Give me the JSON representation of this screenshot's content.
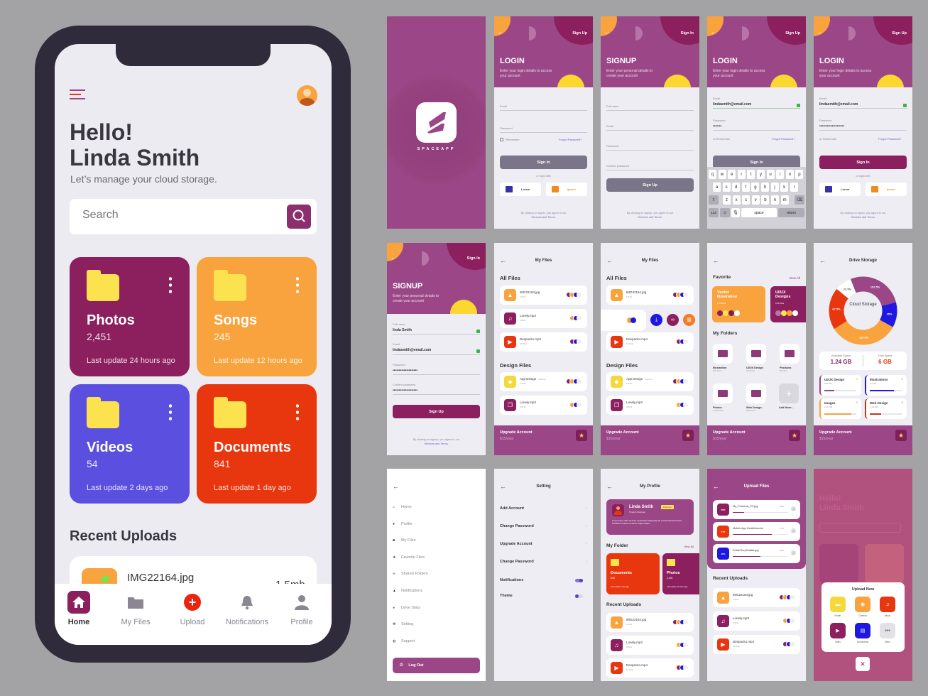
{
  "main": {
    "greeting": "Hello!",
    "name": "Linda Smith",
    "subtitle": "Let’s manage your cloud storage.",
    "search_placeholder": "Search",
    "categories": [
      {
        "name": "Photos",
        "count": "2,451",
        "updated": "Last update 24 hours ago",
        "color": "#8c1f5e"
      },
      {
        "name": "Songs",
        "count": "245",
        "updated": "Last update 12 hours ago",
        "color": "#f8a33d"
      },
      {
        "name": "Videos",
        "count": "54",
        "updated": "Last update 2 days ago",
        "color": "#5b4fdf"
      },
      {
        "name": "Documents",
        "count": "841",
        "updated": "Last update 1 day ago",
        "color": "#e8360f"
      }
    ],
    "recent_title": "Recent Uploads",
    "recent_file": {
      "name": "IMG22164.jpg",
      "size": "1.5mb"
    },
    "nav": [
      "Home",
      "My Files",
      "Upload",
      "Notifications",
      "Profile"
    ],
    "nav_active": "Home"
  },
  "splash": {
    "brand": "SPACEAPP"
  },
  "login": {
    "title": "LOGIN",
    "subtitle": "Enter your login details to access your account",
    "top_link": "Sign Up",
    "email_label": "Email",
    "password_label": "Password",
    "remember": "Remember",
    "forgot": "Forgot Password?",
    "sign_in": "Sign In",
    "or": "or login with",
    "social": [
      "Lorem",
      "Ipsum"
    ],
    "footer": "By clicking on signin, you agree to our",
    "footer_link": "Services and Terms."
  },
  "signup": {
    "title": "SIGNUP",
    "subtitle": "Enter your personal details to create your account",
    "top_link": "Sign In",
    "fields": [
      "Full name",
      "Email",
      "Password",
      "Confirm password"
    ],
    "button": "Sign Up",
    "footer": "By clicking on signup, you agree to our",
    "footer_link": "Services and Terms."
  },
  "login_filled": {
    "email": "lindasmith@email.com",
    "password_typing": "•••••••",
    "password_full": "••••••••••••••••••••"
  },
  "keyboard": {
    "rows": [
      [
        "q",
        "w",
        "e",
        "r",
        "t",
        "y",
        "u",
        "i",
        "o",
        "p"
      ],
      [
        "a",
        "s",
        "d",
        "f",
        "g",
        "h",
        "j",
        "k",
        "l"
      ],
      [
        "z",
        "x",
        "c",
        "v",
        "b",
        "n",
        "m"
      ]
    ],
    "numbers": "123",
    "space": "space",
    "return": "return"
  },
  "signup_filled": {
    "full_name": "linda Smith",
    "email": "lindasmith@email.com",
    "password": "••••••••••••••••••••",
    "confirm": "••••••••••••••••••••"
  },
  "my_files": {
    "title": "My Files",
    "all_files": "All Files",
    "design_files": "Design Files",
    "files": [
      {
        "name": "IMG22164.jpg",
        "size": "1.5mb",
        "icon": "image-icon",
        "color": "#f8a33d"
      },
      {
        "name": "Lonely.mp3",
        "size": "3.5mb",
        "icon": "music-icon",
        "color": "#8c1f5e"
      },
      {
        "name": "Despacito.mp4",
        "size": "10.5mb",
        "icon": "video-icon",
        "color": "#e8360f"
      }
    ],
    "design": [
      {
        "name": "App Design",
        "tag": "drawing",
        "size": "1.5mb",
        "icon": "diamond-icon",
        "color": "#f5d83c"
      },
      {
        "name": "Lonely.mp3",
        "size": "3.5mb",
        "icon": "copy-icon",
        "color": "#8c1f5e"
      }
    ]
  },
  "upgrade": {
    "title": "Upgrade Account",
    "price": "$15/year"
  },
  "favorites": {
    "title": "Favorite",
    "view_all": "View All",
    "cards": [
      {
        "name": "Vector Illustration",
        "count": "105 Files",
        "color": "#f8a33d"
      },
      {
        "name": "UI/UX Designs",
        "count": "154 Files",
        "color": "#8c1f5e"
      }
    ],
    "folders_title": "My Folders",
    "folders": [
      {
        "name": "Illustration",
        "count": "105 Files"
      },
      {
        "name": "UI/UX Design",
        "count": "150 Files"
      },
      {
        "name": "Products",
        "count": "59 Files"
      },
      {
        "name": "Photos",
        "count": "2,310 Files"
      },
      {
        "name": "Web Design",
        "count": "310 Files"
      }
    ],
    "add_more": "Add More..."
  },
  "drive": {
    "title": "Drive Storage",
    "center": "Cloud Storage",
    "segments": [
      {
        "label": "102.5%",
        "color": "#9b4787",
        "share": 0.27
      },
      {
        "label": "45%",
        "color": "#1f18e0",
        "share": 0.12
      },
      {
        "label": "112.5%",
        "color": "#f8a33d",
        "share": 0.33
      },
      {
        "label": "67.5%",
        "color": "#e8360f",
        "share": 0.2
      },
      {
        "label": "22.5%",
        "color": "#ffffff",
        "share": 0.08
      }
    ],
    "available_label": "Available Space",
    "available": "1.24 GB",
    "total_label": "Total Space",
    "total": "6 GB",
    "categories": [
      {
        "name": "UI/UX Design",
        "size": "500 MB",
        "color": "#9b4787",
        "fill": 0.3
      },
      {
        "name": "Illustrations",
        "size": "1.6 GB",
        "color": "#1f18e0",
        "fill": 0.75
      },
      {
        "name": "Images",
        "size": "2.10 GB",
        "color": "#f8a33d",
        "fill": 0.85
      },
      {
        "name": "Web Design",
        "size": "1.12 GB",
        "color": "#c0391b",
        "fill": 0.35
      }
    ]
  },
  "menu": {
    "items": [
      {
        "label": "Home",
        "icon": "home-icon",
        "glyph": "⌂"
      },
      {
        "label": "Profile",
        "icon": "user-icon",
        "glyph": "●"
      },
      {
        "label": "My Files",
        "icon": "folder-icon",
        "glyph": "■"
      },
      {
        "label": "Favorite Files",
        "icon": "star-icon",
        "glyph": "★"
      },
      {
        "label": "Shared Folders",
        "icon": "link-icon",
        "glyph": "∞"
      },
      {
        "label": "Notifications",
        "icon": "bell-icon",
        "glyph": "▲"
      },
      {
        "label": "Drive Stats",
        "icon": "pie-chart-icon",
        "glyph": "◕"
      },
      {
        "label": "Setting",
        "icon": "gear-icon",
        "glyph": "✻"
      },
      {
        "label": "Support",
        "icon": "lifebuoy-icon",
        "glyph": "◍"
      }
    ],
    "logout": "Log Out"
  },
  "settings": {
    "title": "Setting",
    "items": [
      "Add Account",
      "Change Password",
      "Upgrade Account",
      "Change Password"
    ],
    "notifications": "Notifications",
    "theme": "Theme",
    "notifications_on": true,
    "theme_on": false
  },
  "profile": {
    "title": "My Profile",
    "name": "Linda Smith",
    "badge": "Premium",
    "role": "Product Designer",
    "bio": "Lorem ipsum dolor sit amet, consectetur adipiscing elit, sed do eiusmod tempor incididunt ut labore et dolore magna aliqua.",
    "folder_title": "My Folder",
    "view_all": "View All",
    "folders": [
      {
        "name": "Documents",
        "count": "845",
        "updated": "Last update 1 day ago",
        "color": "#e8360f"
      },
      {
        "name": "Photos",
        "count": "2,451",
        "updated": "Last update 24 hours ago",
        "color": "#8c1f5e"
      }
    ],
    "recent_title": "Recent Uploads"
  },
  "upload": {
    "title": "Upload Files",
    "items": [
      {
        "name": "My_Personal_CV.jpg",
        "type": "PDF",
        "progress": 20,
        "progress_label": "20%",
        "color": "#8c1f5e"
      },
      {
        "name": "Mobile App Guidelines.txt",
        "type": "TXT",
        "progress": 70,
        "progress_label": "70%",
        "color": "#e8360f"
      },
      {
        "name": "Dubai Burj Khalifa.jpg",
        "type": "JPG",
        "progress": 50,
        "progress_label": "50%",
        "color": "#1f18e0"
      }
    ],
    "recent_title": "Recent Uploads"
  },
  "upload_new": {
    "title": "Upload New",
    "options": [
      {
        "label": "Folder",
        "color": "#f5d83c",
        "glyph": "▬"
      },
      {
        "label": "Camera",
        "color": "#f8a33d",
        "glyph": "◉"
      },
      {
        "label": "Music",
        "color": "#e8360f",
        "glyph": "♫"
      },
      {
        "label": "Video",
        "color": "#8c1f5e",
        "glyph": "▶"
      },
      {
        "label": "Documents",
        "color": "#1f18e0",
        "glyph": "▤"
      },
      {
        "label": "Other",
        "color": "#e2e1e8",
        "glyph": "•••"
      }
    ],
    "close": "✕"
  }
}
